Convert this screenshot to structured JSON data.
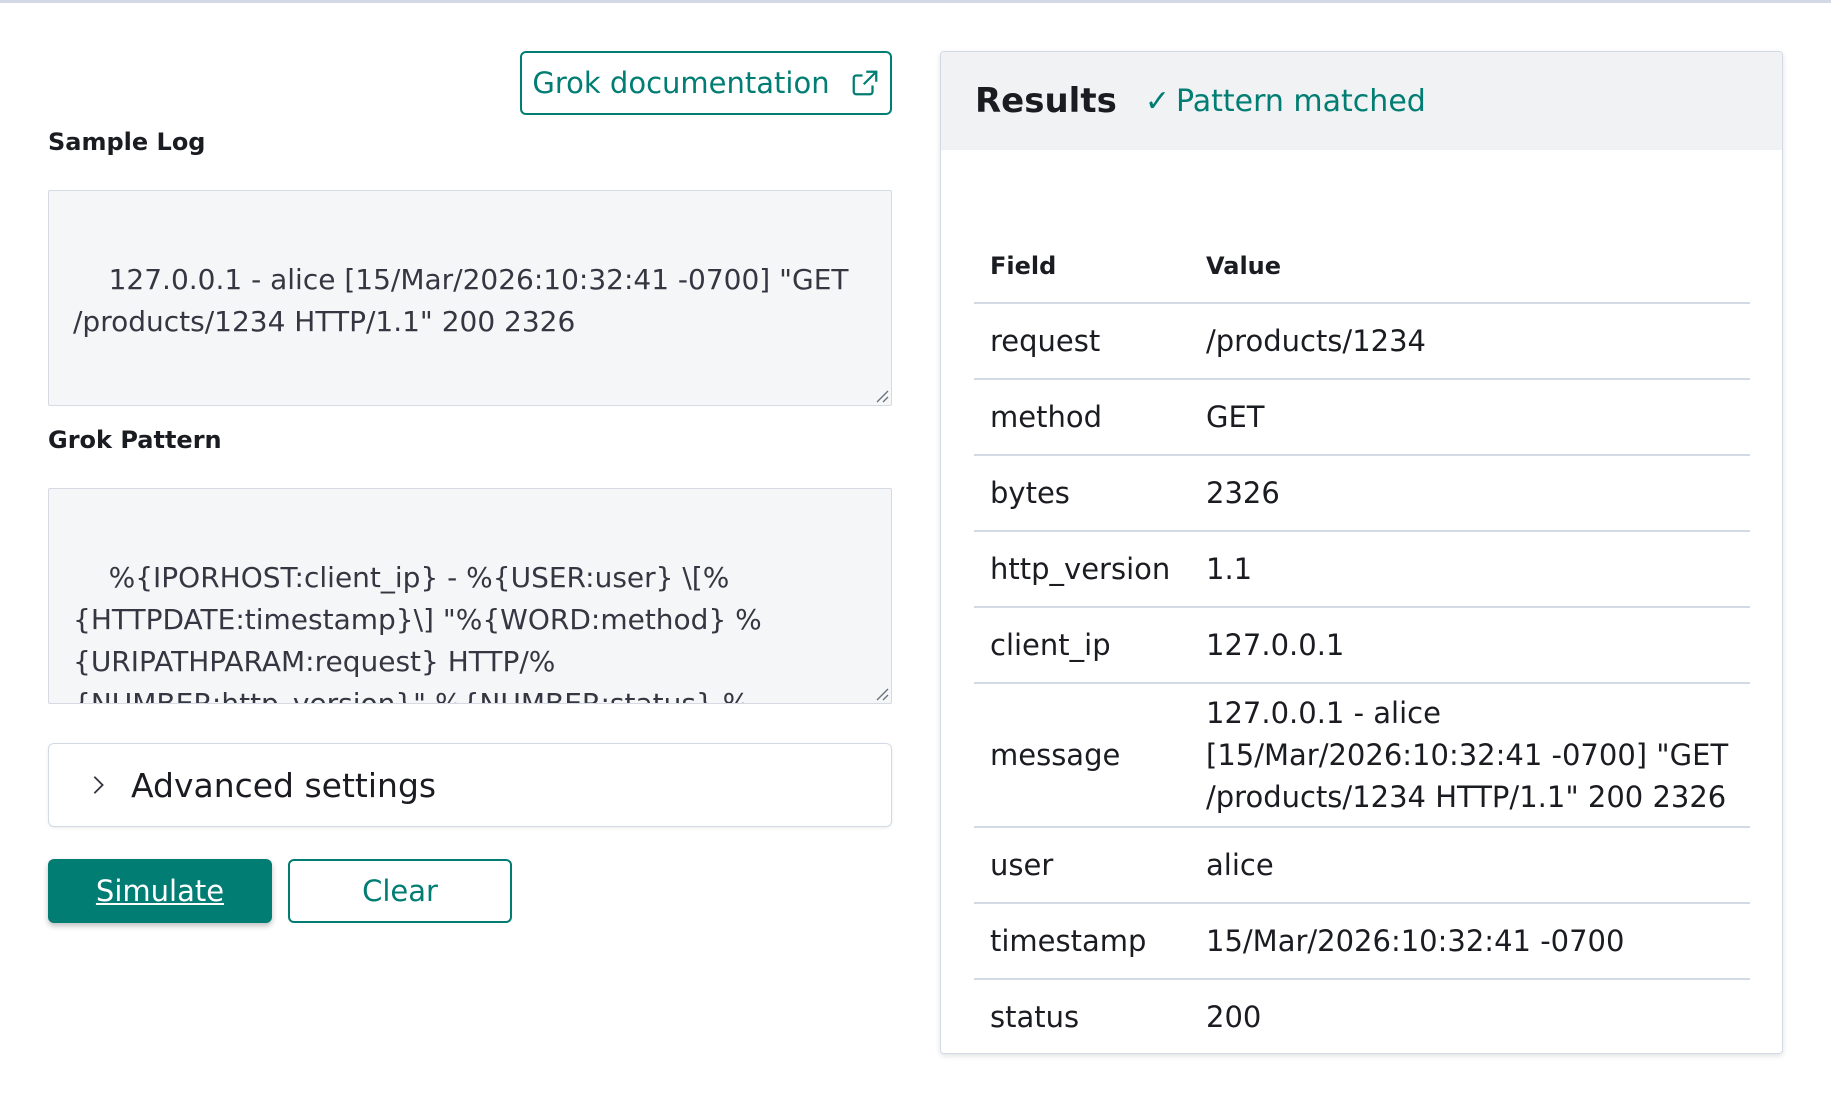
{
  "left": {
    "doc_link_label": "Grok documentation",
    "sample_log_label": "Sample Log",
    "sample_log_value": "127.0.0.1 - alice [15/Mar/2026:10:32:41 -0700] \"GET /products/1234 HTTP/1.1\" 200 2326",
    "grok_pattern_label": "Grok Pattern",
    "grok_pattern_value": "%{IPORHOST:client_ip} - %{USER:user} \\[%{HTTPDATE:timestamp}\\] \"%{WORD:method} %{URIPATHPARAM:request} HTTP/%{NUMBER:http_version}\" %{NUMBER:status} %{NUMBER:bytes}",
    "advanced_settings_label": "Advanced settings",
    "simulate_label": "Simulate",
    "clear_label": "Clear"
  },
  "results": {
    "title": "Results",
    "status_text": "Pattern matched",
    "status_icon": "check-icon",
    "columns": [
      "Field",
      "Value"
    ],
    "rows": [
      {
        "field": "request",
        "value": "/products/1234"
      },
      {
        "field": "method",
        "value": "GET"
      },
      {
        "field": "bytes",
        "value": "2326"
      },
      {
        "field": "http_version",
        "value": "1.1"
      },
      {
        "field": "client_ip",
        "value": "127.0.0.1"
      },
      {
        "field": "message",
        "value": "127.0.0.1 - alice [15/Mar/2026:10:32:41 -0700] \"GET /products/1234 HTTP/1.1\" 200 2326"
      },
      {
        "field": "user",
        "value": "alice"
      },
      {
        "field": "timestamp",
        "value": "15/Mar/2026:10:32:41 -0700"
      },
      {
        "field": "status",
        "value": "200"
      }
    ]
  },
  "colors": {
    "accent": "#017d73",
    "input_bg": "#f5f6f8",
    "border": "#d3dae6"
  }
}
